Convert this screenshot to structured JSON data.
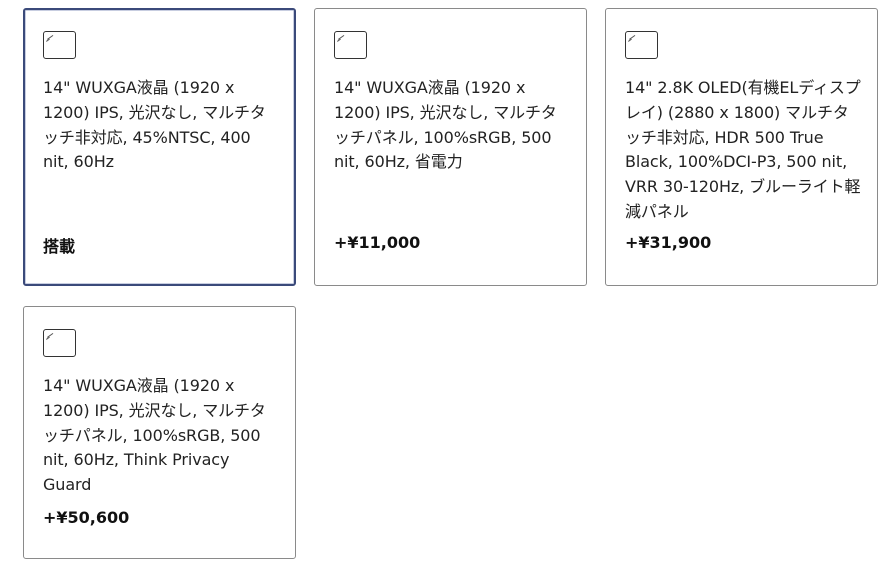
{
  "options": [
    {
      "description": "14\" WUXGA液晶 (1920 x 1200) IPS, 光沢なし, マルチタッチ非対応, 45%NTSC, 400 nit, 60Hz",
      "price": "搭載",
      "selected": true,
      "icon": "display-icon"
    },
    {
      "description": "14\" WUXGA液晶 (1920 x 1200) IPS, 光沢なし, マルチタッチパネル, 100%sRGB, 500 nit, 60Hz, 省電力",
      "price": "+¥11,000",
      "selected": false,
      "icon": "display-icon"
    },
    {
      "description": "14\" 2.8K OLED(有機ELディスプレイ) (2880 x 1800) マルチタッチ非対応, HDR 500 True Black, 100%DCI-P3, 500 nit, VRR 30-120Hz, ブルーライト軽減パネル",
      "price": "+¥31,900",
      "selected": false,
      "icon": "display-icon"
    },
    {
      "description": "14\" WUXGA液晶 (1920 x 1200) IPS, 光沢なし, マルチタッチパネル, 100%sRGB, 500 nit, 60Hz, Think Privacy Guard",
      "price": "+¥50,600",
      "selected": false,
      "icon": "display-icon"
    }
  ],
  "colors": {
    "selected_border": "#3b4a7a",
    "card_border": "#8a8a8a",
    "text": "#222222"
  }
}
